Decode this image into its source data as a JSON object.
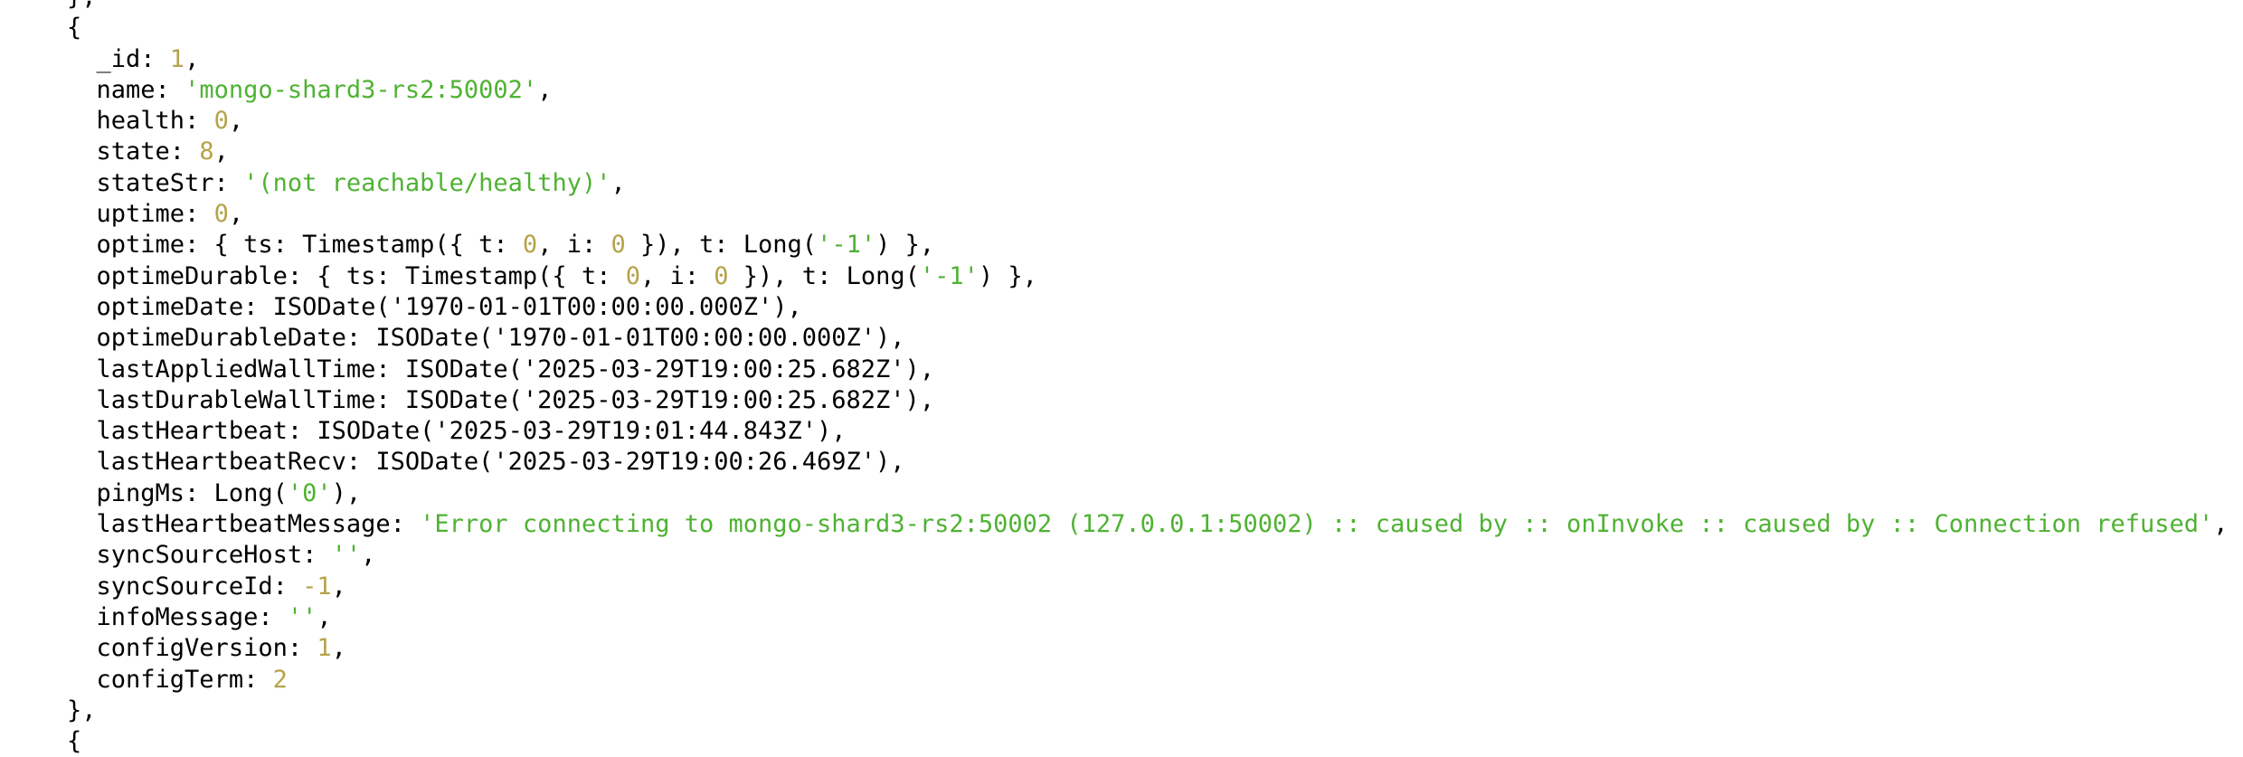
{
  "colors": {
    "text": "#000000",
    "string": "#4fb233",
    "number": "#b5a34a",
    "background": "#ffffff"
  },
  "lines": [
    {
      "indent": 0,
      "parts": [
        {
          "t": "p",
          "v": "},"
        }
      ]
    },
    {
      "indent": 0,
      "parts": [
        {
          "t": "p",
          "v": "{"
        }
      ]
    },
    {
      "indent": 1,
      "parts": [
        {
          "t": "p",
          "v": "_id: "
        },
        {
          "t": "n",
          "v": "1"
        },
        {
          "t": "p",
          "v": ","
        }
      ]
    },
    {
      "indent": 1,
      "parts": [
        {
          "t": "p",
          "v": "name: "
        },
        {
          "t": "s",
          "v": "'mongo-shard3-rs2:50002'"
        },
        {
          "t": "p",
          "v": ","
        }
      ]
    },
    {
      "indent": 1,
      "parts": [
        {
          "t": "p",
          "v": "health: "
        },
        {
          "t": "n",
          "v": "0"
        },
        {
          "t": "p",
          "v": ","
        }
      ]
    },
    {
      "indent": 1,
      "parts": [
        {
          "t": "p",
          "v": "state: "
        },
        {
          "t": "n",
          "v": "8"
        },
        {
          "t": "p",
          "v": ","
        }
      ]
    },
    {
      "indent": 1,
      "parts": [
        {
          "t": "p",
          "v": "stateStr: "
        },
        {
          "t": "s",
          "v": "'(not reachable/healthy)'"
        },
        {
          "t": "p",
          "v": ","
        }
      ]
    },
    {
      "indent": 1,
      "parts": [
        {
          "t": "p",
          "v": "uptime: "
        },
        {
          "t": "n",
          "v": "0"
        },
        {
          "t": "p",
          "v": ","
        }
      ]
    },
    {
      "indent": 1,
      "parts": [
        {
          "t": "p",
          "v": "optime: { ts: Timestamp({ t: "
        },
        {
          "t": "n",
          "v": "0"
        },
        {
          "t": "p",
          "v": ", i: "
        },
        {
          "t": "n",
          "v": "0"
        },
        {
          "t": "p",
          "v": " }), t: Long("
        },
        {
          "t": "s",
          "v": "'-1'"
        },
        {
          "t": "p",
          "v": ") },"
        }
      ]
    },
    {
      "indent": 1,
      "parts": [
        {
          "t": "p",
          "v": "optimeDurable: { ts: Timestamp({ t: "
        },
        {
          "t": "n",
          "v": "0"
        },
        {
          "t": "p",
          "v": ", i: "
        },
        {
          "t": "n",
          "v": "0"
        },
        {
          "t": "p",
          "v": " }), t: Long("
        },
        {
          "t": "s",
          "v": "'-1'"
        },
        {
          "t": "p",
          "v": ") },"
        }
      ]
    },
    {
      "indent": 1,
      "parts": [
        {
          "t": "p",
          "v": "optimeDate: ISODate('1970-01-01T00:00:00.000Z'),"
        }
      ]
    },
    {
      "indent": 1,
      "parts": [
        {
          "t": "p",
          "v": "optimeDurableDate: ISODate('1970-01-01T00:00:00.000Z'),"
        }
      ]
    },
    {
      "indent": 1,
      "parts": [
        {
          "t": "p",
          "v": "lastAppliedWallTime: ISODate('2025-03-29T19:00:25.682Z'),"
        }
      ]
    },
    {
      "indent": 1,
      "parts": [
        {
          "t": "p",
          "v": "lastDurableWallTime: ISODate('2025-03-29T19:00:25.682Z'),"
        }
      ]
    },
    {
      "indent": 1,
      "parts": [
        {
          "t": "p",
          "v": "lastHeartbeat: ISODate('2025-03-29T19:01:44.843Z'),"
        }
      ]
    },
    {
      "indent": 1,
      "parts": [
        {
          "t": "p",
          "v": "lastHeartbeatRecv: ISODate('2025-03-29T19:00:26.469Z'),"
        }
      ]
    },
    {
      "indent": 1,
      "parts": [
        {
          "t": "p",
          "v": "pingMs: Long("
        },
        {
          "t": "s",
          "v": "'0'"
        },
        {
          "t": "p",
          "v": "),"
        }
      ]
    },
    {
      "indent": 1,
      "parts": [
        {
          "t": "p",
          "v": "lastHeartbeatMessage: "
        },
        {
          "t": "s",
          "v": "'Error connecting to mongo-shard3-rs2:50002 (127.0.0.1:50002) :: caused by :: onInvoke :: caused by :: Connection refused'"
        },
        {
          "t": "p",
          "v": ","
        }
      ]
    },
    {
      "indent": 1,
      "parts": [
        {
          "t": "p",
          "v": "syncSourceHost: "
        },
        {
          "t": "s",
          "v": "''"
        },
        {
          "t": "p",
          "v": ","
        }
      ]
    },
    {
      "indent": 1,
      "parts": [
        {
          "t": "p",
          "v": "syncSourceId: "
        },
        {
          "t": "n",
          "v": "-1"
        },
        {
          "t": "p",
          "v": ","
        }
      ]
    },
    {
      "indent": 1,
      "parts": [
        {
          "t": "p",
          "v": "infoMessage: "
        },
        {
          "t": "s",
          "v": "''"
        },
        {
          "t": "p",
          "v": ","
        }
      ]
    },
    {
      "indent": 1,
      "parts": [
        {
          "t": "p",
          "v": "configVersion: "
        },
        {
          "t": "n",
          "v": "1"
        },
        {
          "t": "p",
          "v": ","
        }
      ]
    },
    {
      "indent": 1,
      "parts": [
        {
          "t": "p",
          "v": "configTerm: "
        },
        {
          "t": "n",
          "v": "2"
        }
      ]
    },
    {
      "indent": 0,
      "parts": [
        {
          "t": "p",
          "v": "},"
        }
      ]
    },
    {
      "indent": 0,
      "parts": [
        {
          "t": "p",
          "v": "{"
        }
      ]
    }
  ]
}
